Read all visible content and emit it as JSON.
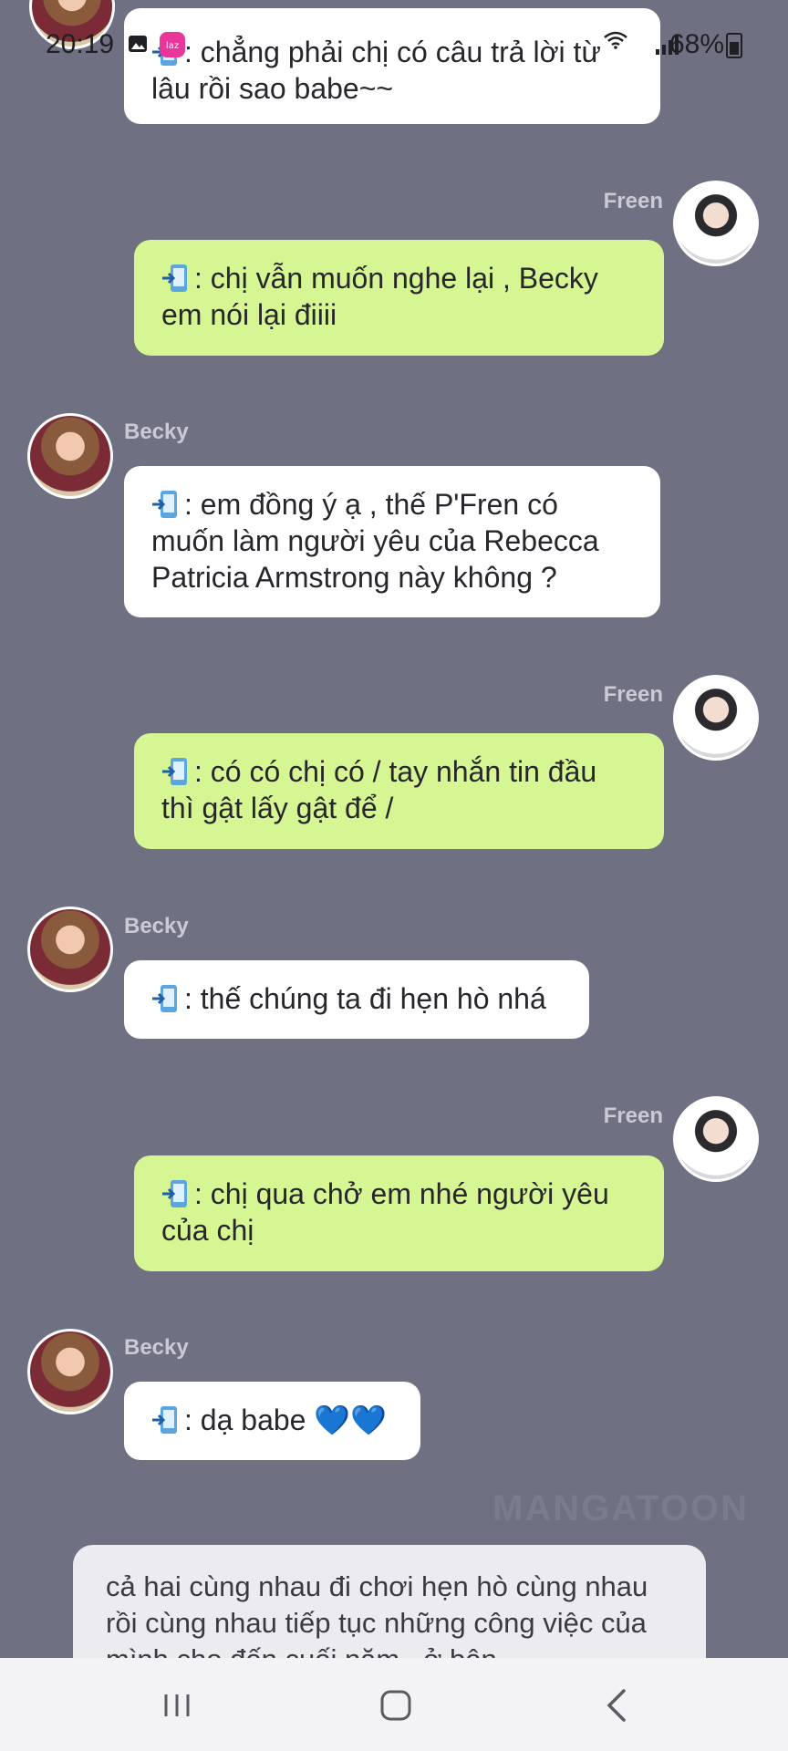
{
  "status_bar": {
    "time": "20:19",
    "battery": "68%"
  },
  "messages": [
    {
      "sender": "",
      "side": "left",
      "text": ": chẳng phải chị có câu trả lời từ lâu rồi sao babe~~"
    },
    {
      "sender": "Freen",
      "side": "right",
      "text": ": chị vẫn muốn nghe lại , Becky em nói lại điiii"
    },
    {
      "sender": "Becky",
      "side": "left",
      "text": ": em đồng ý ạ , thế P'Fren có muốn làm người yêu của Rebecca Patricia Armstrong này không ?"
    },
    {
      "sender": "Freen",
      "side": "right",
      "text": ": có có chị có / tay nhắn tin đầu thì gật lấy gật để /"
    },
    {
      "sender": "Becky",
      "side": "left",
      "text": ": thế chúng ta đi hẹn hò nhá"
    },
    {
      "sender": "Freen",
      "side": "right",
      "text": ": chị qua chở em nhé người yêu của chị"
    },
    {
      "sender": "Becky",
      "side": "left",
      "text": ": dạ babe 💙💙"
    }
  ],
  "narration": "cả hai cùng nhau đi chơi hẹn hò cùng nhau rồi cùng nhau tiếp tục những công việc của mình cho đến cuối năm , ở bên",
  "watermark": "MANGATOON",
  "colors": {
    "background": "#6f7182",
    "left_bubble": "#ffffff",
    "right_bubble": "#d6f593"
  },
  "icons": [
    "gallery-icon",
    "lazada-app-icon",
    "wifi-icon",
    "signal-icon",
    "battery-icon",
    "phone-sms-icon",
    "recent-apps-icon",
    "home-icon",
    "back-icon"
  ]
}
